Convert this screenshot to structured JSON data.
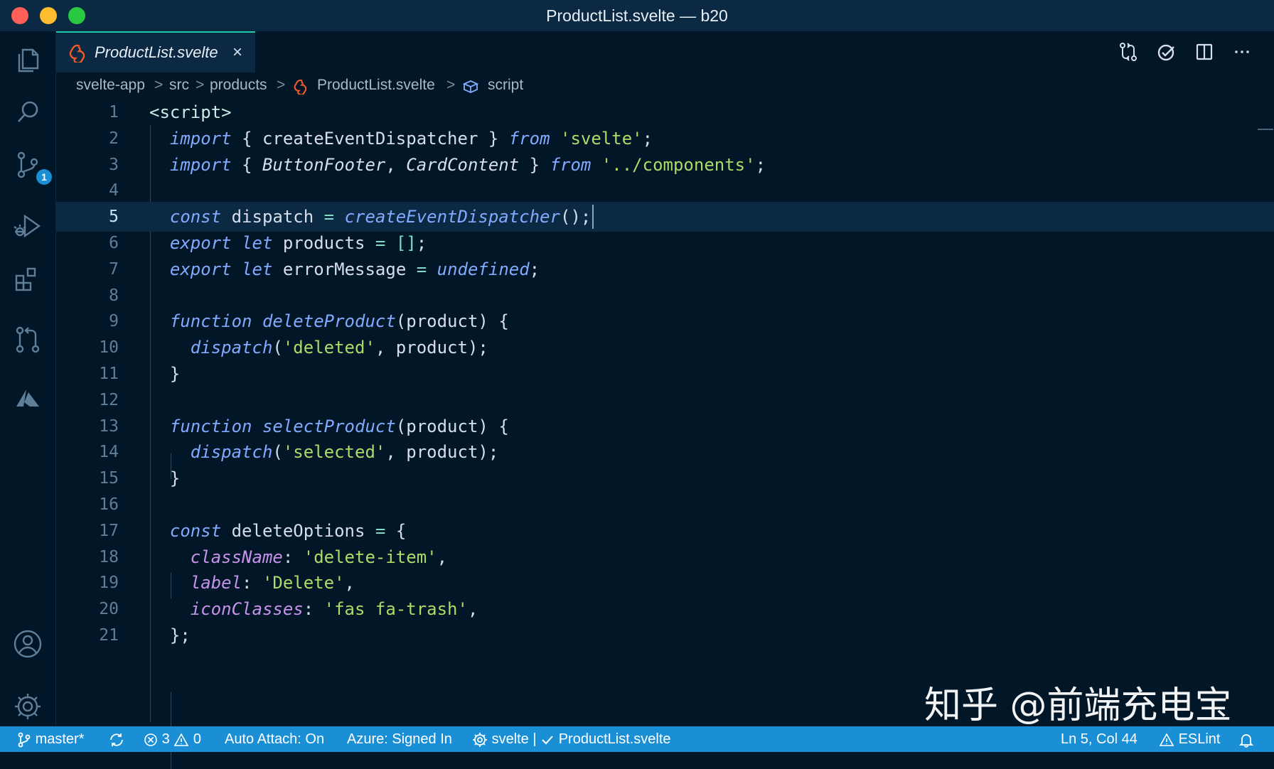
{
  "window": {
    "title": "ProductList.svelte — b20"
  },
  "activity_bar": {
    "items": [
      {
        "name": "explorer"
      },
      {
        "name": "search"
      },
      {
        "name": "source-control",
        "badge": "1"
      },
      {
        "name": "run-debug"
      },
      {
        "name": "extensions"
      },
      {
        "name": "pull-requests"
      },
      {
        "name": "azure"
      },
      {
        "name": "accounts"
      },
      {
        "name": "settings"
      }
    ]
  },
  "tab": {
    "label": "ProductList.svelte",
    "close": "×"
  },
  "breadcrumb": {
    "items": [
      "svelte-app",
      "src",
      "products",
      "ProductList.svelte",
      "script"
    ],
    "separator": ">"
  },
  "editor": {
    "current_line": 5,
    "line_numbers": [
      "1",
      "2",
      "3",
      "4",
      "5",
      "6",
      "7",
      "8",
      "9",
      "10",
      "11",
      "12",
      "13",
      "14",
      "15",
      "16",
      "17",
      "18",
      "19",
      "20",
      "21"
    ],
    "lines": [
      "<script>",
      "  import { createEventDispatcher } from 'svelte';",
      "  import { ButtonFooter, CardContent } from '../components';",
      "",
      "  const dispatch = createEventDispatcher();",
      "  export let products = [];",
      "  export let errorMessage = undefined;",
      "",
      "  function deleteProduct(product) {",
      "    dispatch('deleted', product);",
      "  }",
      "",
      "  function selectProduct(product) {",
      "    dispatch('selected', product);",
      "  }",
      "",
      "  const deleteOptions = {",
      "    className: 'delete-item',",
      "    label: 'Delete',",
      "    iconClasses: 'fas fa-trash',",
      "  };"
    ]
  },
  "statusbar": {
    "branch": "master*",
    "errors": "0",
    "error_count": "3",
    "warnings": "0",
    "auto_attach": "Auto Attach: On",
    "azure": "Azure: Signed In",
    "svelte": "svelte",
    "svelte_sep": "|",
    "file_check": "ProductList.svelte",
    "position": "Ln 5, Col 44",
    "eslint": "ESLint"
  },
  "watermark": "知乎 @前端充电宝",
  "colors": {
    "background": "#011627",
    "statusbar": "#1a8fd6",
    "accent": "#21c7a8",
    "line_highlight": "#0b2942"
  }
}
